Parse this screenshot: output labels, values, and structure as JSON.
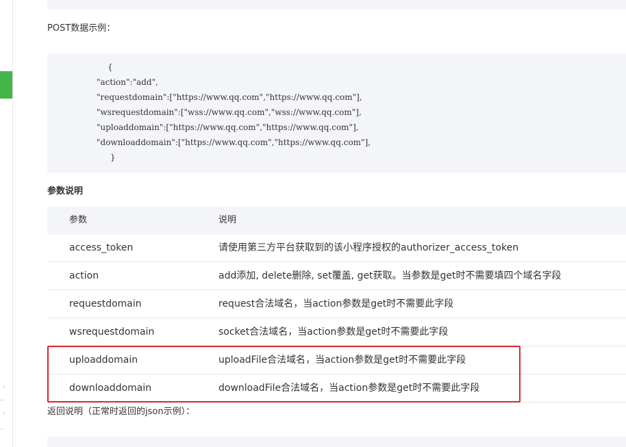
{
  "post_example": {
    "label": "POST数据示例：",
    "code_lines": [
      "{",
      "\"action\":\"add\",",
      "\"requestdomain\":[\"https://www.qq.com\",\"https://www.qq.com\"],",
      "\"wsrequestdomain\":[\"wss://www.qq.com\",\"wss://www.qq.com\"],",
      "\"uploaddomain\":[\"https://www.qq.com\",\"https://www.qq.com\"],",
      "\"downloaddomain\":[\"https://www.qq.com\",\"https://www.qq.com\"],",
      "}"
    ]
  },
  "params": {
    "heading": "参数说明",
    "columns": [
      "参数",
      "说明"
    ],
    "rows": [
      {
        "name": "access_token",
        "desc": "请使用第三方平台获取到的该小程序授权的authorizer_access_token"
      },
      {
        "name": "action",
        "desc": "add添加, delete删除, set覆盖, get获取。当参数是get时不需要填四个域名字段"
      },
      {
        "name": "requestdomain",
        "desc": "request合法域名，当action参数是get时不需要此字段"
      },
      {
        "name": "wsrequestdomain",
        "desc": "socket合法域名，当action参数是get时不需要此字段"
      },
      {
        "name": "uploaddomain",
        "desc": "uploadFile合法域名，当action参数是get时不需要此字段"
      },
      {
        "name": "downloaddomain",
        "desc": "downloadFile合法域名，当action参数是get时不需要此字段"
      }
    ]
  },
  "return_section": {
    "label": "返回说明（正常时返回的json示例）："
  },
  "colors": {
    "accent_green": "#44b549",
    "highlight_red": "#d9262c",
    "block_bg": "#f4f5f9"
  }
}
